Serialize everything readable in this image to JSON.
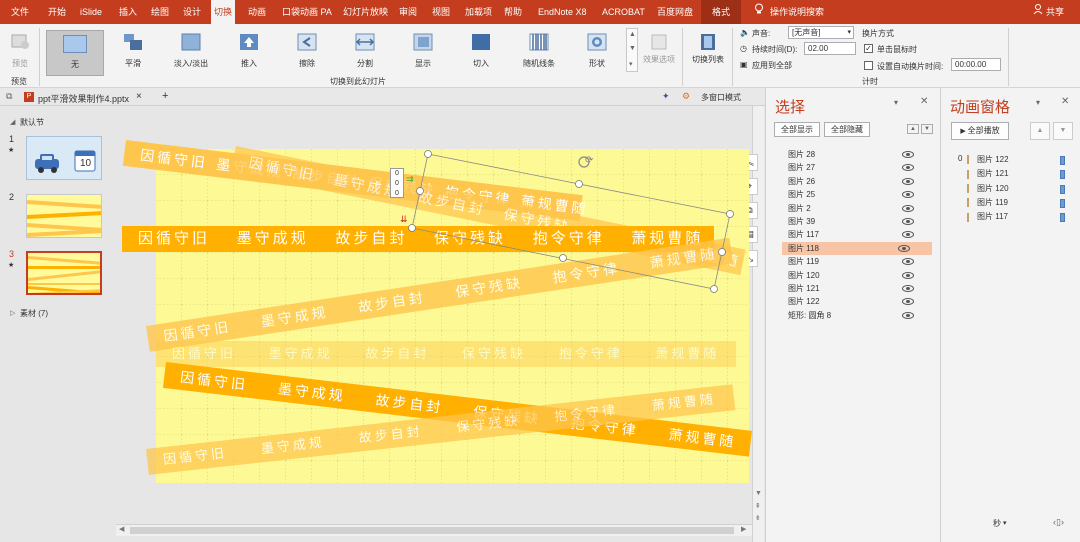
{
  "menubar": {
    "tabs": [
      "文件",
      "开始",
      "iSlide",
      "插入",
      "绘图",
      "设计",
      "切换",
      "动画",
      "口袋动画 PA",
      "幻灯片放映",
      "审阅",
      "视图",
      "加载项",
      "帮助",
      "EndNote X8",
      "ACROBAT",
      "百度网盘"
    ],
    "format_tab": "格式",
    "tell_me": "操作说明搜索",
    "share": "共享"
  },
  "ribbon": {
    "preview_label": "预览",
    "preview_group": "预览",
    "transitions": [
      "无",
      "平滑",
      "淡入/淡出",
      "推入",
      "擦除",
      "分割",
      "显示",
      "切入",
      "随机线条",
      "形状"
    ],
    "effect_options": "效果选项",
    "transitions_group": "切换到此幻灯片",
    "switch_list": "切换列表",
    "sound_label": "声音:",
    "sound_value": "[无声音]",
    "duration_label": "持续时间(D):",
    "duration_value": "02.00",
    "apply_all": "应用到全部",
    "switch_mode": "换片方式",
    "on_click": "单击鼠标时",
    "auto_after": "设置自动换片时间:",
    "auto_value": "00:00.00",
    "timing_group": "计时"
  },
  "doc_tab": {
    "filename": "ppt平滑效果制作4.pptx",
    "close": "×",
    "add": "+",
    "multi_window": "多窗口模式"
  },
  "thumbnails": {
    "section_default": "默认节",
    "slides": [
      {
        "num": "1",
        "star": "★"
      },
      {
        "num": "2",
        "star": ""
      },
      {
        "num": "3",
        "star": "★"
      }
    ],
    "calendar_day": "10",
    "section_material": "素材 (7)"
  },
  "slide": {
    "phrases": [
      "因循守旧",
      "墨守成规",
      "故步自封",
      "保守残缺",
      "抱令守律",
      "萧规曹随"
    ],
    "anim_tags": [
      "0",
      "0",
      "0"
    ]
  },
  "selection_pane": {
    "title": "选择",
    "show_all": "全部显示",
    "hide_all": "全部隐藏",
    "items": [
      "图片 28",
      "图片 27",
      "图片 26",
      "图片 25",
      "图片 2",
      "图片 39",
      "图片 117",
      "图片 118",
      "图片 119",
      "图片 120",
      "图片 121",
      "图片 122",
      "矩形: 圆角 8"
    ],
    "selected_index": 7
  },
  "animation_pane": {
    "title": "动画窗格",
    "play_all": "全部播放",
    "group_num": "0",
    "items": [
      "图片 122",
      "图片 121",
      "图片 120",
      "图片 119",
      "图片 117"
    ],
    "seconds": "秒"
  },
  "colors": {
    "accent": "#c33d1e",
    "slide_bg": "#fdfa96",
    "strip_solid": "#ffb000",
    "strip_light": "#ffc64d",
    "selected_row": "#f8c4a6"
  }
}
